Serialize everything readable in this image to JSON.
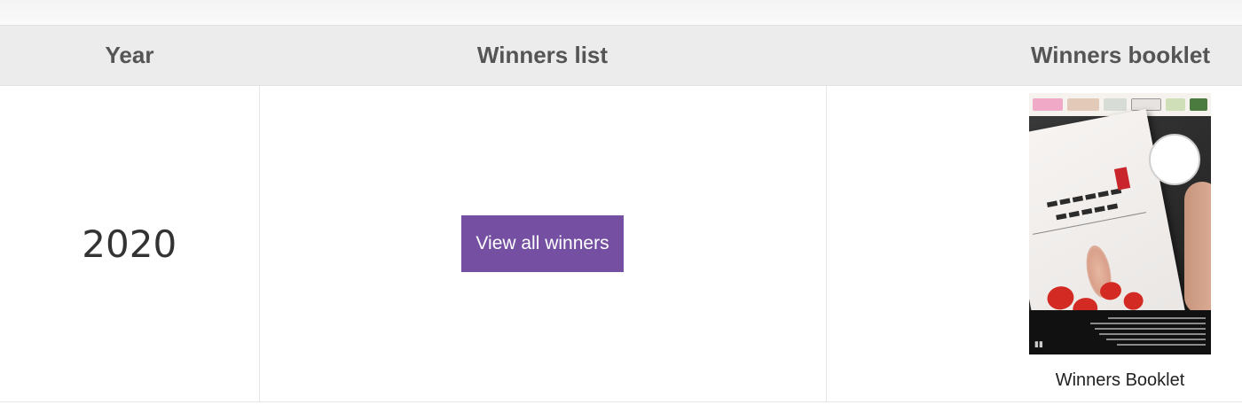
{
  "table": {
    "headers": {
      "year": "Year",
      "list": "Winners list",
      "booklet": "Winners booklet"
    },
    "rows": [
      {
        "year": "2020",
        "button_label": "View all winners",
        "booklet_caption": "Winners Booklet"
      }
    ]
  },
  "colors": {
    "button_bg": "#7550a2",
    "header_bg": "#ececec",
    "header_text": "#555555"
  },
  "icons": {
    "booklet_cover": "winners-booklet-cover-image"
  }
}
